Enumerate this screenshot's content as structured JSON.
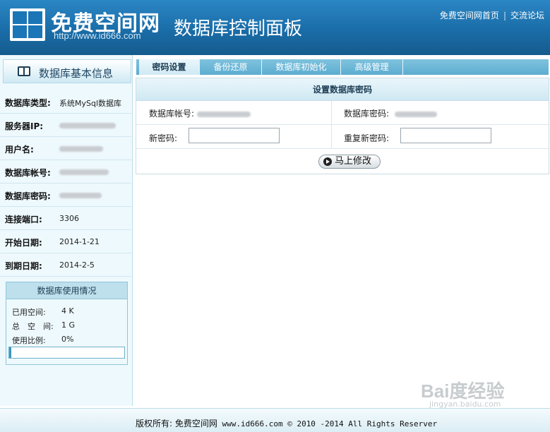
{
  "header": {
    "site_name": "免费空间网",
    "site_url": "http://www.id666.com",
    "panel_title": "数据库控制面板",
    "links": [
      "免费空间网首页",
      "交流论坛"
    ]
  },
  "sidebar": {
    "title": "数据库基本信息",
    "items": [
      {
        "label": "数据库类型:",
        "value": "系统MySql数据库"
      },
      {
        "label": "服务器IP:",
        "value": ""
      },
      {
        "label": "用户名:",
        "value": ""
      },
      {
        "label": "数据库帐号:",
        "value": ""
      },
      {
        "label": "数据库密码:",
        "value": ""
      },
      {
        "label": "连接端口:",
        "value": "3306"
      },
      {
        "label": "开始日期:",
        "value": "2014-1-21"
      },
      {
        "label": "到期日期:",
        "value": "2014-2-5"
      }
    ],
    "usage": {
      "title": "数据库使用情况",
      "used_label": "已用空间:",
      "used_value": "4 K",
      "total_label": "总　空　间:",
      "total_value": "1 G",
      "ratio_label": "使用比例:",
      "ratio_value": "0%",
      "ratio_fraction": 0.02
    }
  },
  "tabs": [
    {
      "label": "密码设置",
      "active": true
    },
    {
      "label": "备份还原",
      "active": false
    },
    {
      "label": "数据库初始化",
      "active": false
    },
    {
      "label": "高级管理",
      "active": false
    }
  ],
  "form": {
    "title": "设置数据库密码",
    "account_label": "数据库帐号:",
    "password_label": "数据库密码:",
    "new_password_label": "新密码:",
    "repeat_password_label": "重复新密码:",
    "new_password_value": "",
    "repeat_password_value": "",
    "submit_label": "马上修改"
  },
  "footer": {
    "prefix": "版权所有: 免费空间网",
    "copyright": " www.id666.com © 2010 -2014 All Rights Reserver"
  },
  "watermark": {
    "brand": "Bai度经验",
    "url": "jingyan.baidu.com"
  }
}
